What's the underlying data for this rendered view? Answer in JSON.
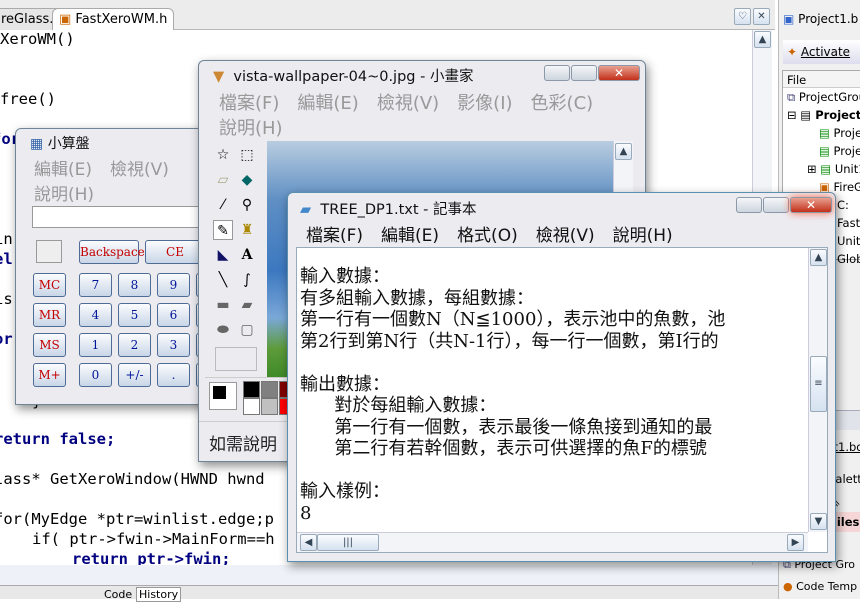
{
  "ide": {
    "tabs": [
      {
        "label": "reGlass.h"
      },
      {
        "label": "FastXeroWM.h"
      }
    ],
    "code": [
      "XeroWM()",
      "free()",
      "for",
      "in",
      "el",
      "is",
      "or",
      "}",
      "return false;",
      "lass* GetXeroWindow(HWND hwnd",
      "for(MyEdge *ptr=winlist.edge;p",
      "if( ptr->fwin->MainForm==h",
      "return ptr->fwin;"
    ],
    "bottom_tabs": [
      "Code",
      "History"
    ],
    "right_panel": {
      "title": "Project1.b",
      "activate": "Activate",
      "file_header": "File",
      "tree": [
        "ProjectGrou",
        "Project",
        "Proje",
        "Proje",
        "Unit1",
        "FireG",
        "C:",
        "Fast",
        "Unit2",
        "Glob"
      ],
      "lower": [
        "tt1.bd",
        "Palett",
        "Files",
        "Project Gro",
        "Code Temp"
      ]
    }
  },
  "calculator": {
    "title": "小算盤",
    "menu": [
      "編輯(E)",
      "檢視(V)",
      "說明(H)"
    ],
    "display": "",
    "top_buttons": [
      "Backspace",
      "CE"
    ],
    "memory": [
      "MC",
      "MR",
      "MS",
      "M+"
    ],
    "keys": [
      [
        "7",
        "8",
        "9"
      ],
      [
        "4",
        "5",
        "6"
      ],
      [
        "1",
        "2",
        "3"
      ],
      [
        "0",
        "+/-",
        "."
      ]
    ]
  },
  "paint": {
    "title": "vista-wallpaper-04~0.jpg - 小畫家",
    "menu": [
      "檔案(F)",
      "編輯(E)",
      "檢視(V)",
      "影像(I)",
      "色彩(C)",
      "說明(H)"
    ],
    "tools": [
      "free-select",
      "rect-select",
      "eraser",
      "fill",
      "picker",
      "magnifier",
      "pencil",
      "brush",
      "airbrush",
      "text",
      "line",
      "curve",
      "rectangle",
      "polygon",
      "ellipse",
      "rounded-rect"
    ],
    "palette": [
      "#000000",
      "#808080",
      "#800000",
      "#ffffff",
      "#c0c0c0",
      "#ff0000"
    ],
    "status": "如需說明"
  },
  "notepad": {
    "title": "TREE_DP1.txt - 記事本",
    "menu": [
      "檔案(F)",
      "編輯(E)",
      "格式(O)",
      "檢視(V)",
      "說明(H)"
    ],
    "lines": [
      "輸入數據：",
      "有多組輸入數據，每組數據：",
      "第一行有一個數N（N≦1000），表示池中的魚數，池",
      "第2行到第N行（共N-1行），每一行一個數，第I行的",
      "",
      "輸出數據：",
      "      對於每組輸入數據：",
      "      第一行有一個數，表示最後一條魚接到通知的最",
      "      第二行有若幹個數，表示可供選擇的魚F的標號",
      "",
      "輸入樣例：",
      "8"
    ]
  }
}
